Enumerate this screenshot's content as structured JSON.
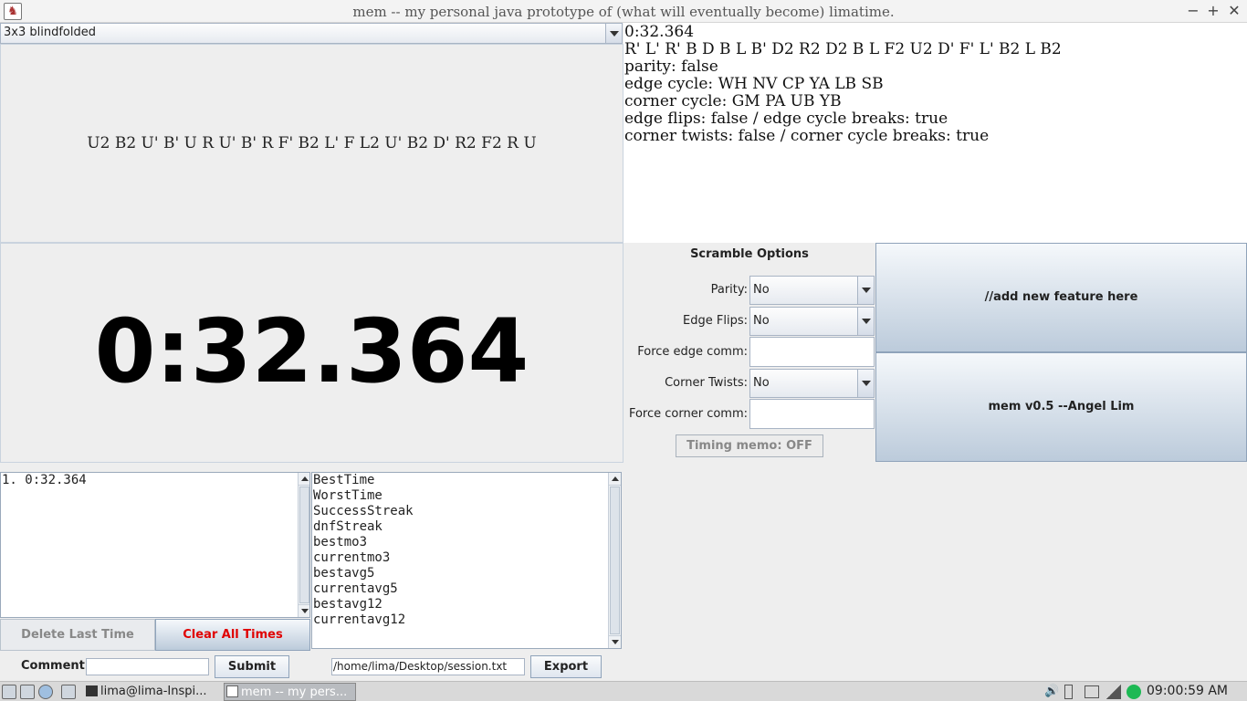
{
  "window": {
    "title": "mem -- my personal java prototype of (what will eventually become) limatime.",
    "controls": [
      "−",
      "+",
      "✕"
    ]
  },
  "puzzle_select": {
    "value": "3x3 blindfolded"
  },
  "scramble_text": "U2 B2 U' B' U R U' B' R F' B2 L' F L2 U' B2 D' R2 F2 R U",
  "timer": "0:32.364",
  "info": {
    "lines": [
      "0:32.364",
      "R' L' R' B D B L B' D2 R2 D2 B L F2 U2 D' F' L' B2 L B2",
      "parity: false",
      "edge cycle: WH NV CP YA LB SB",
      "corner cycle: GM PA UB YB",
      "edge flips: false / edge cycle breaks: true",
      "corner twists: false / corner cycle breaks: true"
    ]
  },
  "scramble_options": {
    "heading": "Scramble Options",
    "parity_label": "Parity:",
    "parity_value": "No",
    "edge_flips_label": "Edge Flips:",
    "edge_flips_value": "No",
    "force_edge_label": "Force edge comm:",
    "force_edge_value": "",
    "corner_twists_label": "Corner Twists:",
    "corner_twists_value": "No",
    "force_corner_label": "Force corner comm:",
    "force_corner_value": "",
    "timing_memo": "Timing memo: OFF"
  },
  "feature_button": "//add new feature here",
  "about_button": "mem v0.5 --Angel Lim",
  "times_list": [
    "1. 0:32.364"
  ],
  "stats_list": [
    "BestTime",
    "WorstTime",
    "SuccessStreak",
    "dnfStreak",
    "bestmo3",
    "currentmo3",
    "bestavg5",
    "currentavg5",
    "bestavg12",
    "currentavg12"
  ],
  "delete_last": "Delete Last Time",
  "clear_all": "Clear All Times",
  "clear_color": "#e00000",
  "comment_label": "Comment",
  "comment_value": "",
  "submit": "Submit",
  "export_path": "/home/lima/Desktop/session.txt",
  "export": "Export",
  "taskbar": {
    "task1": "lima@lima-Inspi...",
    "task2": "mem -- my pers...",
    "clock": "09:00:59 AM"
  }
}
